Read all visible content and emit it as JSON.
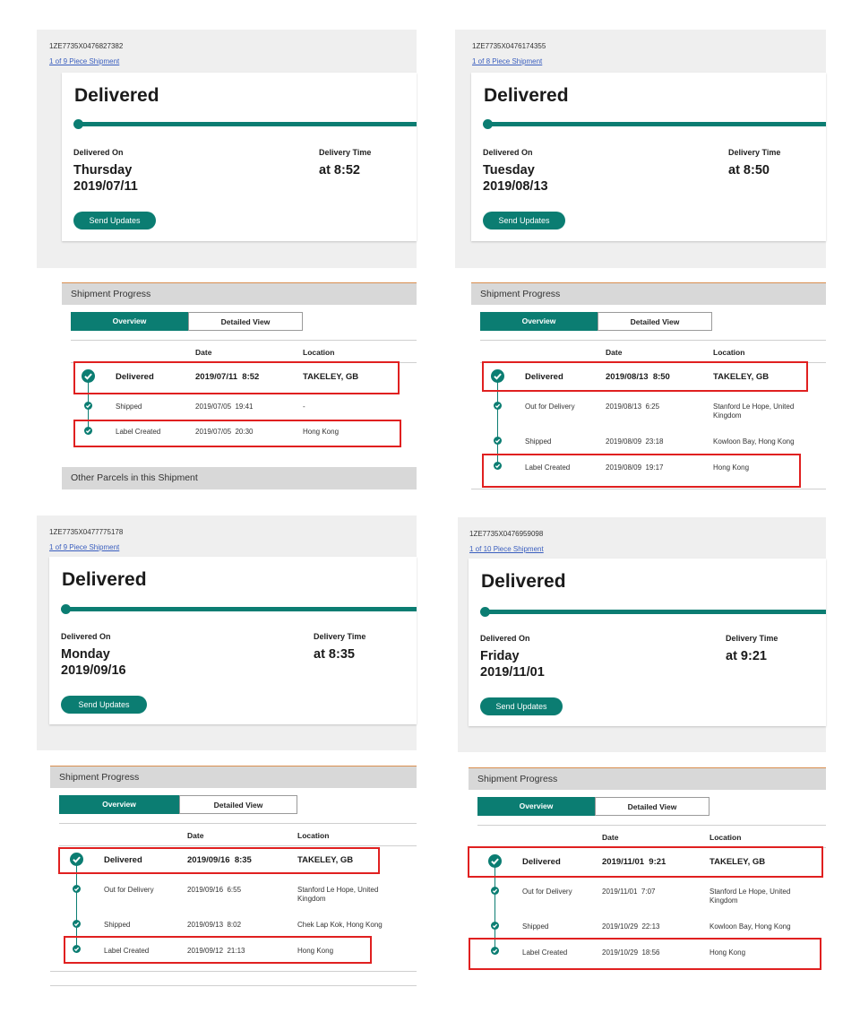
{
  "colors": {
    "accent": "#0b7d72",
    "highlight": "#e02020",
    "panel": "#efefef",
    "header": "#d8d8d8"
  },
  "labels": {
    "delivered_on": "Delivered On",
    "delivery_time": "Delivery Time",
    "send_updates": "Send Updates",
    "shipment_progress": "Shipment Progress",
    "overview": "Overview",
    "detailed_view": "Detailed View",
    "col_date": "Date",
    "col_location": "Location",
    "other_parcels": "Other Parcels in this Shipment"
  },
  "shipments": [
    {
      "tracking": "1ZE7735X0476827382",
      "piece": "1 of 9 Piece Shipment",
      "status": "Delivered",
      "day": "Thursday",
      "date": "2019/07/11",
      "time": "at 8:52",
      "events": [
        {
          "status": "Delivered",
          "date": "2019/07/11  8:52",
          "location": "TAKELEY, GB"
        },
        {
          "status": "Shipped",
          "date": "2019/07/05  19:41",
          "location": "-"
        },
        {
          "status": "Label Created",
          "date": "2019/07/05  20:30",
          "location": "Hong Kong"
        }
      ]
    },
    {
      "tracking": "1ZE7735X0476174355",
      "piece": "1 of 8 Piece Shipment",
      "status": "Delivered",
      "day": "Tuesday",
      "date": "2019/08/13",
      "time": "at 8:50",
      "events": [
        {
          "status": "Delivered",
          "date": "2019/08/13  8:50",
          "location": "TAKELEY, GB"
        },
        {
          "status": "Out for Delivery",
          "date": "2019/08/13  6:25",
          "location": "Stanford Le Hope, United",
          "location2": "Kingdom"
        },
        {
          "status": "Shipped",
          "date": "2019/08/09  23:18",
          "location": "Kowloon Bay, Hong Kong"
        },
        {
          "status": "Label Created",
          "date": "2019/08/09  19:17",
          "location": "Hong Kong"
        }
      ]
    },
    {
      "tracking": "1ZE7735X0477775178",
      "piece": "1 of 9 Piece Shipment",
      "status": "Delivered",
      "day": "Monday",
      "date": "2019/09/16",
      "time": "at 8:35",
      "events": [
        {
          "status": "Delivered",
          "date": "2019/09/16  8:35",
          "location": "TAKELEY, GB"
        },
        {
          "status": "Out for Delivery",
          "date": "2019/09/16  6:55",
          "location": "Stanford Le Hope, United",
          "location2": "Kingdom"
        },
        {
          "status": "Shipped",
          "date": "2019/09/13  8:02",
          "location": "Chek Lap Kok, Hong Kong"
        },
        {
          "status": "Label Created",
          "date": "2019/09/12  21:13",
          "location": "Hong Kong"
        }
      ]
    },
    {
      "tracking": "1ZE7735X0476959098",
      "piece": "1 of 10 Piece Shipment",
      "status": "Delivered",
      "day": "Friday",
      "date": "2019/11/01",
      "time": "at 9:21",
      "events": [
        {
          "status": "Delivered",
          "date": "2019/11/01  9:21",
          "location": "TAKELEY, GB"
        },
        {
          "status": "Out for Delivery",
          "date": "2019/11/01  7:07",
          "location": "Stanford Le Hope, United",
          "location2": "Kingdom"
        },
        {
          "status": "Shipped",
          "date": "2019/10/29  22:13",
          "location": "Kowloon Bay, Hong Kong"
        },
        {
          "status": "Label Created",
          "date": "2019/10/29  18:56",
          "location": "Hong Kong"
        }
      ]
    }
  ]
}
